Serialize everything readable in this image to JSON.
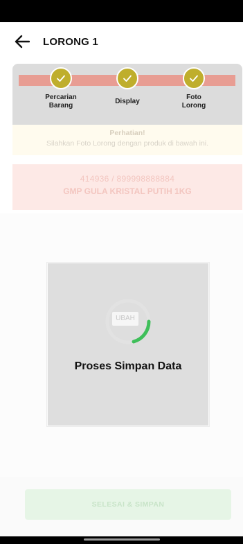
{
  "header": {
    "title": "LORONG 1"
  },
  "stepper": {
    "steps": [
      {
        "label_line1": "Percarian",
        "label_line2": "Barang",
        "done": true
      },
      {
        "label_line1": "Display",
        "label_line2": "",
        "done": true
      },
      {
        "label_line1": "Foto",
        "label_line2": "Lorong",
        "done": true
      }
    ]
  },
  "notice": {
    "title": "Perhatian!",
    "text": "Silahkan Foto Lorong dengan produk di bawah ini."
  },
  "product": {
    "code": "414936 / 899998888884",
    "name": "GMP GULA KRISTAL PUTIH  1KG"
  },
  "photo": {
    "change_label": "UBAH"
  },
  "loading_dialog": {
    "message": "Proses Simpan Data"
  },
  "footer": {
    "save_label": "SELESAI & SIMPAN"
  },
  "colors": {
    "step_track": "#e89d93",
    "step_done": "#bfae2c",
    "spinner": "#3fbf5a"
  }
}
